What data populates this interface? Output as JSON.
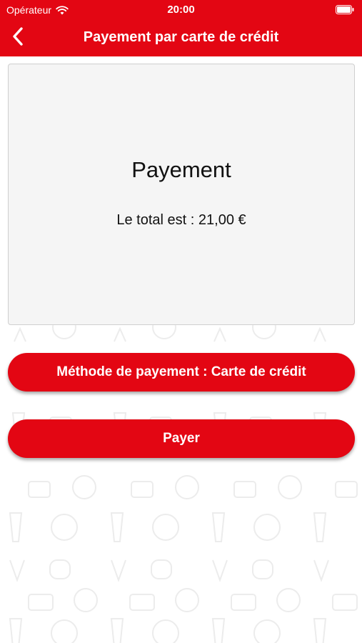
{
  "status_bar": {
    "carrier": "Opérateur",
    "time": "20:00",
    "wifi_icon": "wifi-icon",
    "battery_icon": "battery-icon"
  },
  "nav": {
    "back_icon": "chevron-left-icon",
    "title": "Payement par carte de crédit"
  },
  "card": {
    "title": "Payement",
    "total": "Le total est : 21,00 €"
  },
  "buttons": {
    "method": "Méthode de payement : Carte de crédit",
    "pay": "Payer"
  },
  "colors": {
    "brand_red": "#e30613",
    "card_bg": "#f5f5f5"
  }
}
